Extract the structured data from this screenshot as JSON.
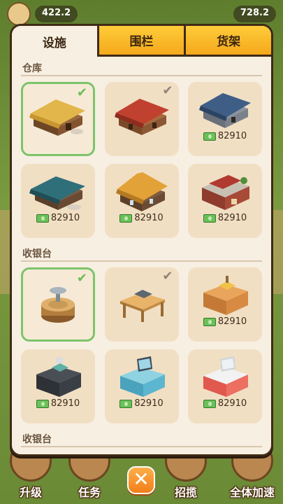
{
  "hud": {
    "coins": "422.2",
    "cash": "728.2"
  },
  "tabs": [
    {
      "label": "设施",
      "active": true
    },
    {
      "label": "围栏",
      "active": false
    },
    {
      "label": "货架",
      "active": false
    }
  ],
  "sections": [
    {
      "title": "仓库",
      "items": [
        {
          "name": "thatched-warehouse",
          "price": "",
          "state": "equipped"
        },
        {
          "name": "red-roof-warehouse",
          "price": "",
          "state": "owned"
        },
        {
          "name": "blue-roof-warehouse",
          "price": "82910",
          "state": "buy"
        },
        {
          "name": "teal-roof-warehouse",
          "price": "82910",
          "state": "buy"
        },
        {
          "name": "orange-roof-warehouse",
          "price": "82910",
          "state": "buy"
        },
        {
          "name": "brick-shop-warehouse",
          "price": "82910",
          "state": "buy"
        }
      ]
    },
    {
      "title": "收银台",
      "items": [
        {
          "name": "stump-scale-counter",
          "price": "",
          "state": "equipped"
        },
        {
          "name": "wooden-table-counter",
          "price": "",
          "state": "owned"
        },
        {
          "name": "wooden-cabinet-counter",
          "price": "82910",
          "state": "buy"
        },
        {
          "name": "dark-register-counter",
          "price": "82910",
          "state": "buy"
        },
        {
          "name": "blue-register-counter",
          "price": "82910",
          "state": "buy"
        },
        {
          "name": "red-register-counter",
          "price": "82910",
          "state": "buy"
        }
      ]
    },
    {
      "title": "收银台",
      "items": []
    }
  ],
  "bottom": {
    "upgrade": "升级",
    "tasks": "任务",
    "close": "✕",
    "recruit": "招揽",
    "speedup": "全体加速"
  },
  "colors": {
    "selected_border": "#7cc46a",
    "tab_inactive": "#f4a81b",
    "panel_bg": "#f7efe2",
    "card_bg": "#f1dfc4"
  }
}
